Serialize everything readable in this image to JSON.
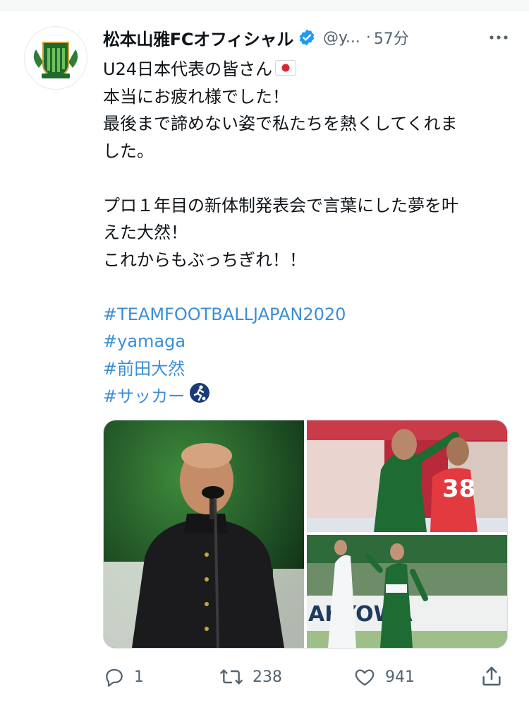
{
  "tweet": {
    "author_name": "松本山雅FCオフィシャル",
    "handle": "@y...",
    "dot": "·",
    "time": "57分",
    "text_lines": [
      "U24日本代表の皆さん",
      "本当にお疲れ様でした！",
      "最後まで諦めない姿で私たちを熱くしてくれま",
      "した。",
      "",
      "プロ１年目の新体制発表会で言葉にした夢を叶",
      "えた大然！",
      "これからもぶっちぎれ！！",
      ""
    ],
    "hashtags": [
      "#TEAMFOOTBALLJAPAN2020",
      "#yamaga",
      "#前田大然",
      "#サッカー"
    ],
    "counts": {
      "replies": "1",
      "retweets": "238",
      "likes": "941"
    }
  },
  "icons": {
    "verified": "verified-badge-icon",
    "more": "more-dots-icon",
    "flag": "japan-flag-emoji",
    "soccer": "soccer-emoji",
    "reply": "reply-icon",
    "retweet": "retweet-icon",
    "like": "heart-icon",
    "share": "share-icon"
  },
  "colors": {
    "hashtag": "#3b8ed8",
    "verified": "#1d9bf0",
    "secondary_text": "#536471"
  }
}
